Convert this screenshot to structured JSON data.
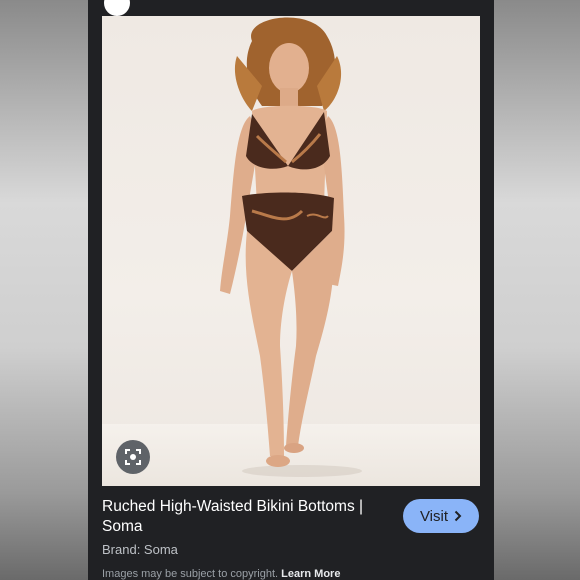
{
  "result": {
    "title": "Ruched High-Waisted Bikini Bottoms | Soma",
    "brand": "Brand: Soma",
    "visit_label": "Visit",
    "copyright_text": "Images may be subject to copyright.",
    "learn_more_label": "Learn More"
  },
  "colors": {
    "panel_bg": "#202124",
    "visit_button": "#8ab4f8",
    "lens_button": "#5f6368"
  },
  "icons": [
    "lens-search-icon",
    "chevron-right-icon"
  ]
}
